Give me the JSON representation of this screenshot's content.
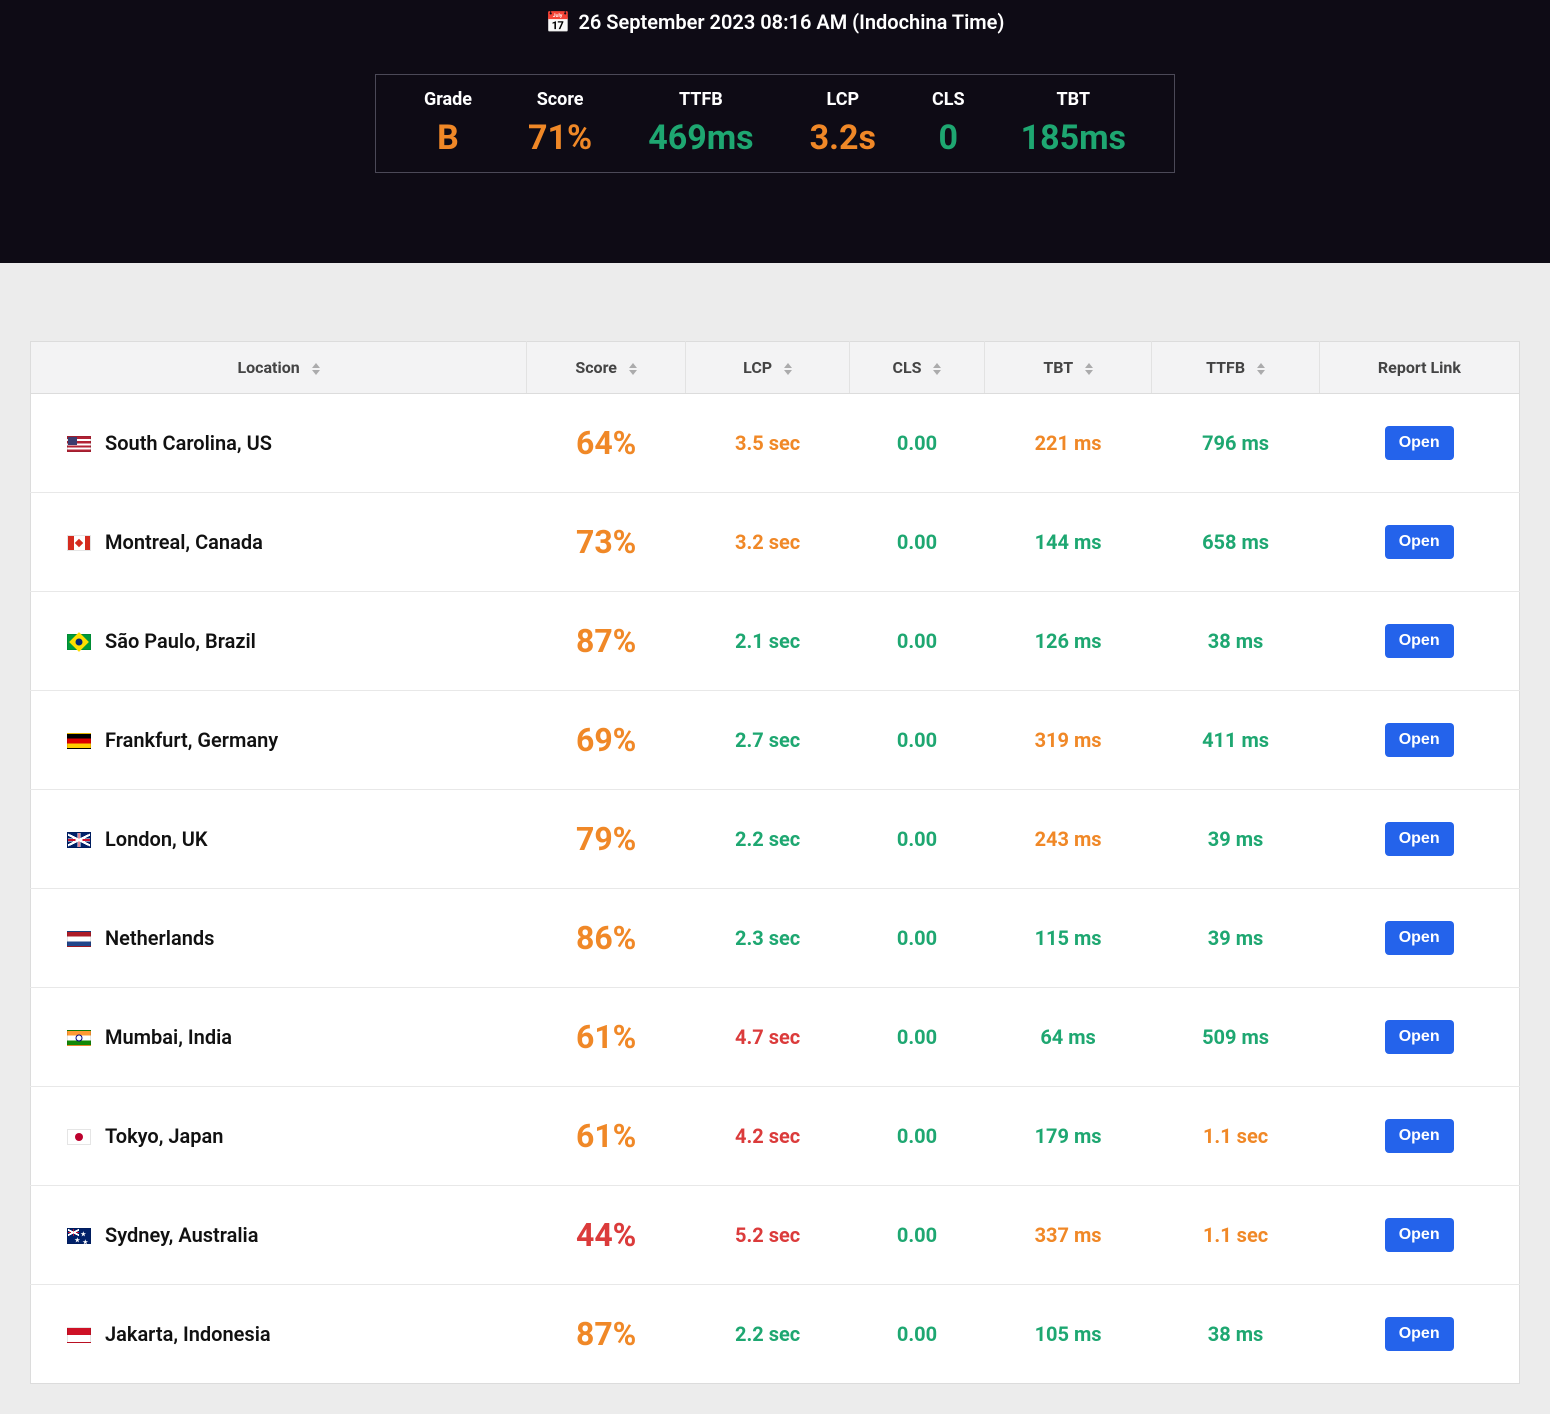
{
  "header": {
    "date_text": "26 September 2023 08:16 AM (Indochina Time)"
  },
  "summary": [
    {
      "label": "Grade",
      "value": "B",
      "color": "c-orange"
    },
    {
      "label": "Score",
      "value": "71%",
      "color": "c-orange"
    },
    {
      "label": "TTFB",
      "value": "469ms",
      "color": "c-green"
    },
    {
      "label": "LCP",
      "value": "3.2s",
      "color": "c-orange"
    },
    {
      "label": "CLS",
      "value": "0",
      "color": "c-green"
    },
    {
      "label": "TBT",
      "value": "185ms",
      "color": "c-green"
    }
  ],
  "table": {
    "columns": {
      "location": "Location",
      "score": "Score",
      "lcp": "LCP",
      "cls": "CLS",
      "tbt": "TBT",
      "ttfb": "TTFB",
      "report": "Report Link"
    },
    "open_label": "Open",
    "rows": [
      {
        "flag": "us",
        "location": "South Carolina, US",
        "score": "64%",
        "score_color": "c-orange",
        "lcp": "3.5 sec",
        "lcp_color": "c-orange",
        "cls": "0.00",
        "cls_color": "c-green",
        "tbt": "221 ms",
        "tbt_color": "c-orange",
        "ttfb": "796 ms",
        "ttfb_color": "c-green"
      },
      {
        "flag": "ca",
        "location": "Montreal, Canada",
        "score": "73%",
        "score_color": "c-orange",
        "lcp": "3.2 sec",
        "lcp_color": "c-orange",
        "cls": "0.00",
        "cls_color": "c-green",
        "tbt": "144 ms",
        "tbt_color": "c-green",
        "ttfb": "658 ms",
        "ttfb_color": "c-green"
      },
      {
        "flag": "br",
        "location": "São Paulo, Brazil",
        "score": "87%",
        "score_color": "c-orange",
        "lcp": "2.1 sec",
        "lcp_color": "c-green",
        "cls": "0.00",
        "cls_color": "c-green",
        "tbt": "126 ms",
        "tbt_color": "c-green",
        "ttfb": "38 ms",
        "ttfb_color": "c-green"
      },
      {
        "flag": "de",
        "location": "Frankfurt, Germany",
        "score": "69%",
        "score_color": "c-orange",
        "lcp": "2.7 sec",
        "lcp_color": "c-green",
        "cls": "0.00",
        "cls_color": "c-green",
        "tbt": "319 ms",
        "tbt_color": "c-orange",
        "ttfb": "411 ms",
        "ttfb_color": "c-green"
      },
      {
        "flag": "uk",
        "location": "London, UK",
        "score": "79%",
        "score_color": "c-orange",
        "lcp": "2.2 sec",
        "lcp_color": "c-green",
        "cls": "0.00",
        "cls_color": "c-green",
        "tbt": "243 ms",
        "tbt_color": "c-orange",
        "ttfb": "39 ms",
        "ttfb_color": "c-green"
      },
      {
        "flag": "nl",
        "location": "Netherlands",
        "score": "86%",
        "score_color": "c-orange",
        "lcp": "2.3 sec",
        "lcp_color": "c-green",
        "cls": "0.00",
        "cls_color": "c-green",
        "tbt": "115 ms",
        "tbt_color": "c-green",
        "ttfb": "39 ms",
        "ttfb_color": "c-green"
      },
      {
        "flag": "in",
        "location": "Mumbai, India",
        "score": "61%",
        "score_color": "c-orange",
        "lcp": "4.7 sec",
        "lcp_color": "c-red",
        "cls": "0.00",
        "cls_color": "c-green",
        "tbt": "64 ms",
        "tbt_color": "c-green",
        "ttfb": "509 ms",
        "ttfb_color": "c-green"
      },
      {
        "flag": "jp",
        "location": "Tokyo, Japan",
        "score": "61%",
        "score_color": "c-orange",
        "lcp": "4.2 sec",
        "lcp_color": "c-red",
        "cls": "0.00",
        "cls_color": "c-green",
        "tbt": "179 ms",
        "tbt_color": "c-green",
        "ttfb": "1.1 sec",
        "ttfb_color": "c-orange"
      },
      {
        "flag": "au",
        "location": "Sydney, Australia",
        "score": "44%",
        "score_color": "c-red",
        "lcp": "5.2 sec",
        "lcp_color": "c-red",
        "cls": "0.00",
        "cls_color": "c-green",
        "tbt": "337 ms",
        "tbt_color": "c-orange",
        "ttfb": "1.1 sec",
        "ttfb_color": "c-orange"
      },
      {
        "flag": "id",
        "location": "Jakarta, Indonesia",
        "score": "87%",
        "score_color": "c-orange",
        "lcp": "2.2 sec",
        "lcp_color": "c-green",
        "cls": "0.00",
        "cls_color": "c-green",
        "tbt": "105 ms",
        "tbt_color": "c-green",
        "ttfb": "38 ms",
        "ttfb_color": "c-green"
      }
    ]
  }
}
